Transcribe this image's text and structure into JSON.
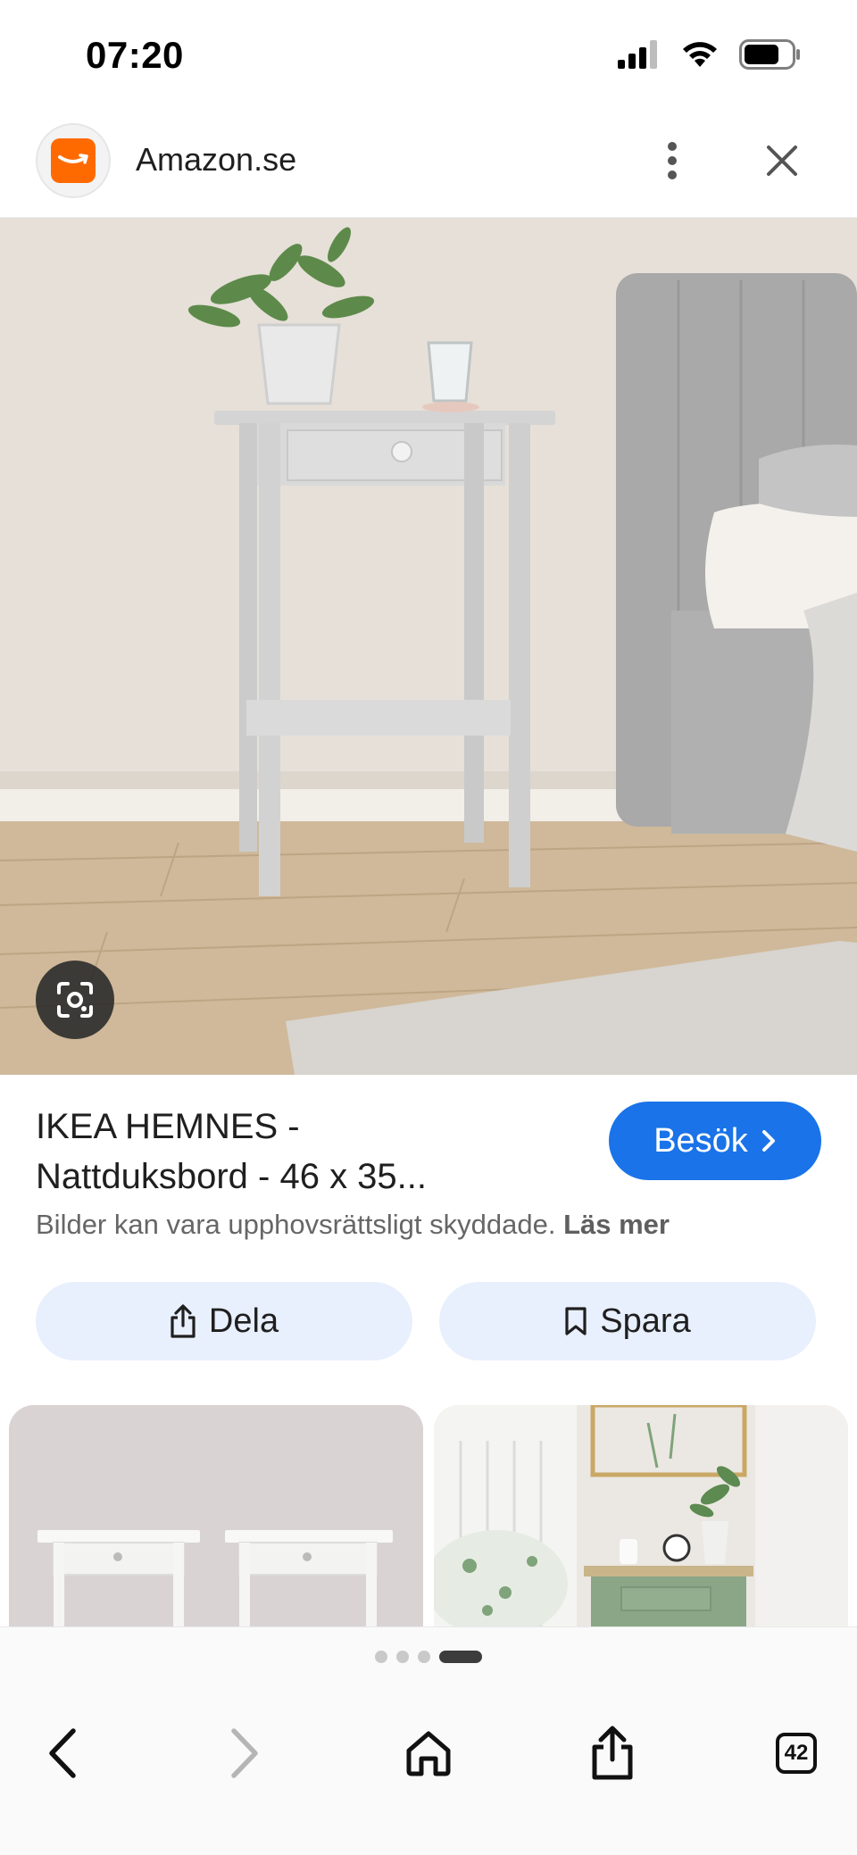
{
  "status_bar": {
    "time": "07:20"
  },
  "header": {
    "site_name": "Amazon.se"
  },
  "product": {
    "title_line1": "IKEA HEMNES -",
    "title_line2": "Nattduksbord - 46 x 35...",
    "visit_label": "Besök",
    "copyright_text": "Bilder kan vara upphovsrättsligt skyddade.",
    "copyright_link": "Läs mer",
    "share_label": "Dela",
    "save_label": "Spara"
  },
  "gallery": {
    "page_count": 4,
    "active_page": 4
  },
  "browser": {
    "tab_count": "42"
  },
  "colors": {
    "accent": "#1a73e8",
    "brand": "#ff6a00",
    "action_bg": "#e8effd"
  },
  "icons": [
    "signal-icon",
    "wifi-icon",
    "battery-icon",
    "amazon-logo-icon",
    "more-vert-icon",
    "close-icon",
    "lens-icon",
    "chevron-right-icon",
    "share-icon",
    "bookmark-icon",
    "back-icon",
    "forward-icon",
    "home-icon",
    "share-upload-icon",
    "tabs-icon"
  ]
}
